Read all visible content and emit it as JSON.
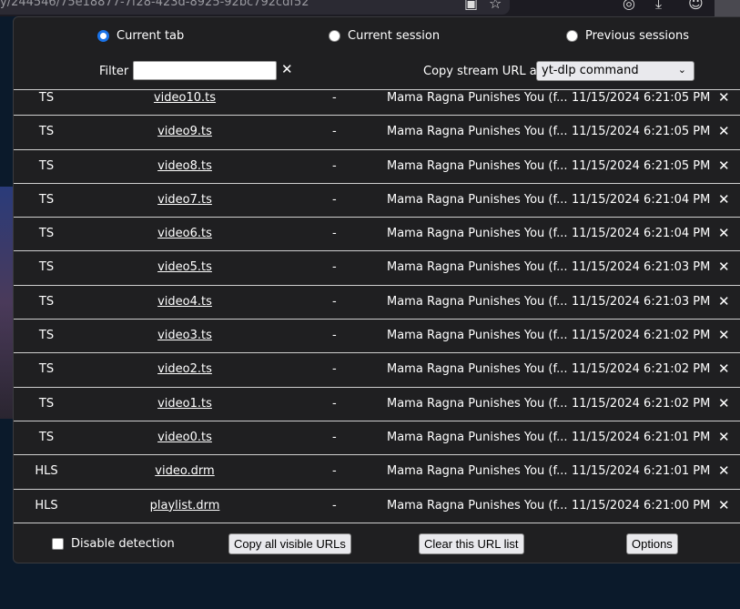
{
  "browser": {
    "url": "y/244546/75e18877-7f28-423d-8925-92bc792cdf52"
  },
  "tabs": [
    {
      "label": "Current tab",
      "selected": true
    },
    {
      "label": "Current session",
      "selected": false
    },
    {
      "label": "Previous sessions",
      "selected": false
    }
  ],
  "filter": {
    "label": "Filter",
    "value": "",
    "clear": "✕"
  },
  "copy": {
    "label": "Copy stream URL as",
    "selected": "yt-dlp command"
  },
  "rows": [
    {
      "type": "TS",
      "name": "video10.ts",
      "size": "-",
      "title": "Mama Ragna Punishes You (f...",
      "time": "11/15/2024 6:21:05 PM"
    },
    {
      "type": "TS",
      "name": "video9.ts",
      "size": "-",
      "title": "Mama Ragna Punishes You (f...",
      "time": "11/15/2024 6:21:05 PM"
    },
    {
      "type": "TS",
      "name": "video8.ts",
      "size": "-",
      "title": "Mama Ragna Punishes You (f...",
      "time": "11/15/2024 6:21:05 PM"
    },
    {
      "type": "TS",
      "name": "video7.ts",
      "size": "-",
      "title": "Mama Ragna Punishes You (f...",
      "time": "11/15/2024 6:21:04 PM"
    },
    {
      "type": "TS",
      "name": "video6.ts",
      "size": "-",
      "title": "Mama Ragna Punishes You (f...",
      "time": "11/15/2024 6:21:04 PM"
    },
    {
      "type": "TS",
      "name": "video5.ts",
      "size": "-",
      "title": "Mama Ragna Punishes You (f...",
      "time": "11/15/2024 6:21:03 PM"
    },
    {
      "type": "TS",
      "name": "video4.ts",
      "size": "-",
      "title": "Mama Ragna Punishes You (f...",
      "time": "11/15/2024 6:21:03 PM"
    },
    {
      "type": "TS",
      "name": "video3.ts",
      "size": "-",
      "title": "Mama Ragna Punishes You (f...",
      "time": "11/15/2024 6:21:02 PM"
    },
    {
      "type": "TS",
      "name": "video2.ts",
      "size": "-",
      "title": "Mama Ragna Punishes You (f...",
      "time": "11/15/2024 6:21:02 PM"
    },
    {
      "type": "TS",
      "name": "video1.ts",
      "size": "-",
      "title": "Mama Ragna Punishes You (f...",
      "time": "11/15/2024 6:21:02 PM"
    },
    {
      "type": "TS",
      "name": "video0.ts",
      "size": "-",
      "title": "Mama Ragna Punishes You (f...",
      "time": "11/15/2024 6:21:01 PM"
    },
    {
      "type": "HLS",
      "name": "video.drm",
      "size": "-",
      "title": "Mama Ragna Punishes You (f...",
      "time": "11/15/2024 6:21:01 PM"
    },
    {
      "type": "HLS",
      "name": "playlist.drm",
      "size": "-",
      "title": "Mama Ragna Punishes You (f...",
      "time": "11/15/2024 6:21:00 PM"
    }
  ],
  "delete_glyph": "✕",
  "footer": {
    "disable_label": "Disable detection",
    "copy_all": "Copy all visible URLs",
    "clear_list": "Clear this URL list",
    "options": "Options"
  }
}
